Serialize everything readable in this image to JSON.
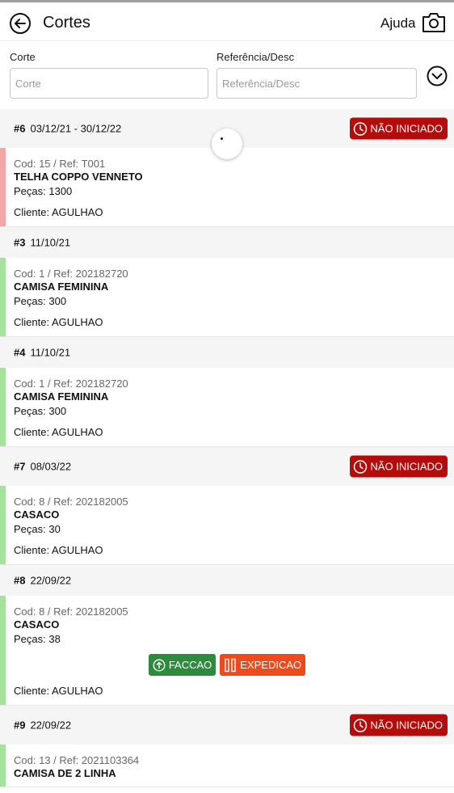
{
  "header": {
    "title": "Cortes",
    "help_label": "Ajuda"
  },
  "filters": {
    "corte_label": "Corte",
    "corte_placeholder": "Corte",
    "corte_value": "",
    "ref_label": "Referência/Desc",
    "ref_placeholder": "Referência/Desc",
    "ref_value": ""
  },
  "colors": {
    "bar_red": "#f3a8a8",
    "bar_green": "#a6e39a",
    "status_bg": "#b40b0b",
    "faccao_bg": "#2e8b3e",
    "expedicao_bg": "#f0491b"
  },
  "cards": [
    {
      "num": "#6",
      "date": "03/12/21 - 30/12/22",
      "status": "NÃO INICIADO",
      "cod": "Cod: 15 / Ref: T001",
      "product": "TELHA COPPO VENNETO",
      "pecas": "Peças: 1300",
      "cliente": "Cliente: AGULHAO",
      "bar": "red"
    },
    {
      "num": "#3",
      "date": "11/10/21",
      "status": "",
      "cod": "Cod: 1 / Ref: 202182720",
      "product": "CAMISA FEMININA",
      "pecas": "Peças: 300",
      "cliente": "Cliente: AGULHAO",
      "bar": "green"
    },
    {
      "num": "#4",
      "date": "11/10/21",
      "status": "",
      "cod": "Cod: 1 / Ref: 202182720",
      "product": "CAMISA FEMININA",
      "pecas": "Peças: 300",
      "cliente": "Cliente: AGULHAO",
      "bar": "green"
    },
    {
      "num": "#7",
      "date": "08/03/22",
      "status": "NÃO INICIADO",
      "cod": "Cod: 8 / Ref: 202182005",
      "product": "CASACO",
      "pecas": "Peças: 30",
      "cliente": "Cliente: AGULHAO",
      "bar": "green"
    },
    {
      "num": "#8",
      "date": "22/09/22",
      "status": "",
      "cod": "Cod: 8 / Ref: 202182005",
      "product": "CASACO",
      "pecas": "Peças: 38",
      "cliente": "Cliente: AGULHAO",
      "bar": "green",
      "actions": [
        "FACCAO",
        "EXPEDICAO"
      ]
    },
    {
      "num": "#9",
      "date": "22/09/22",
      "status": "NÃO INICIADO",
      "cod": "Cod: 13 / Ref: 2021103364",
      "product": "CAMISA DE 2 LINHA",
      "pecas": "",
      "cliente": "",
      "bar": "green"
    }
  ]
}
